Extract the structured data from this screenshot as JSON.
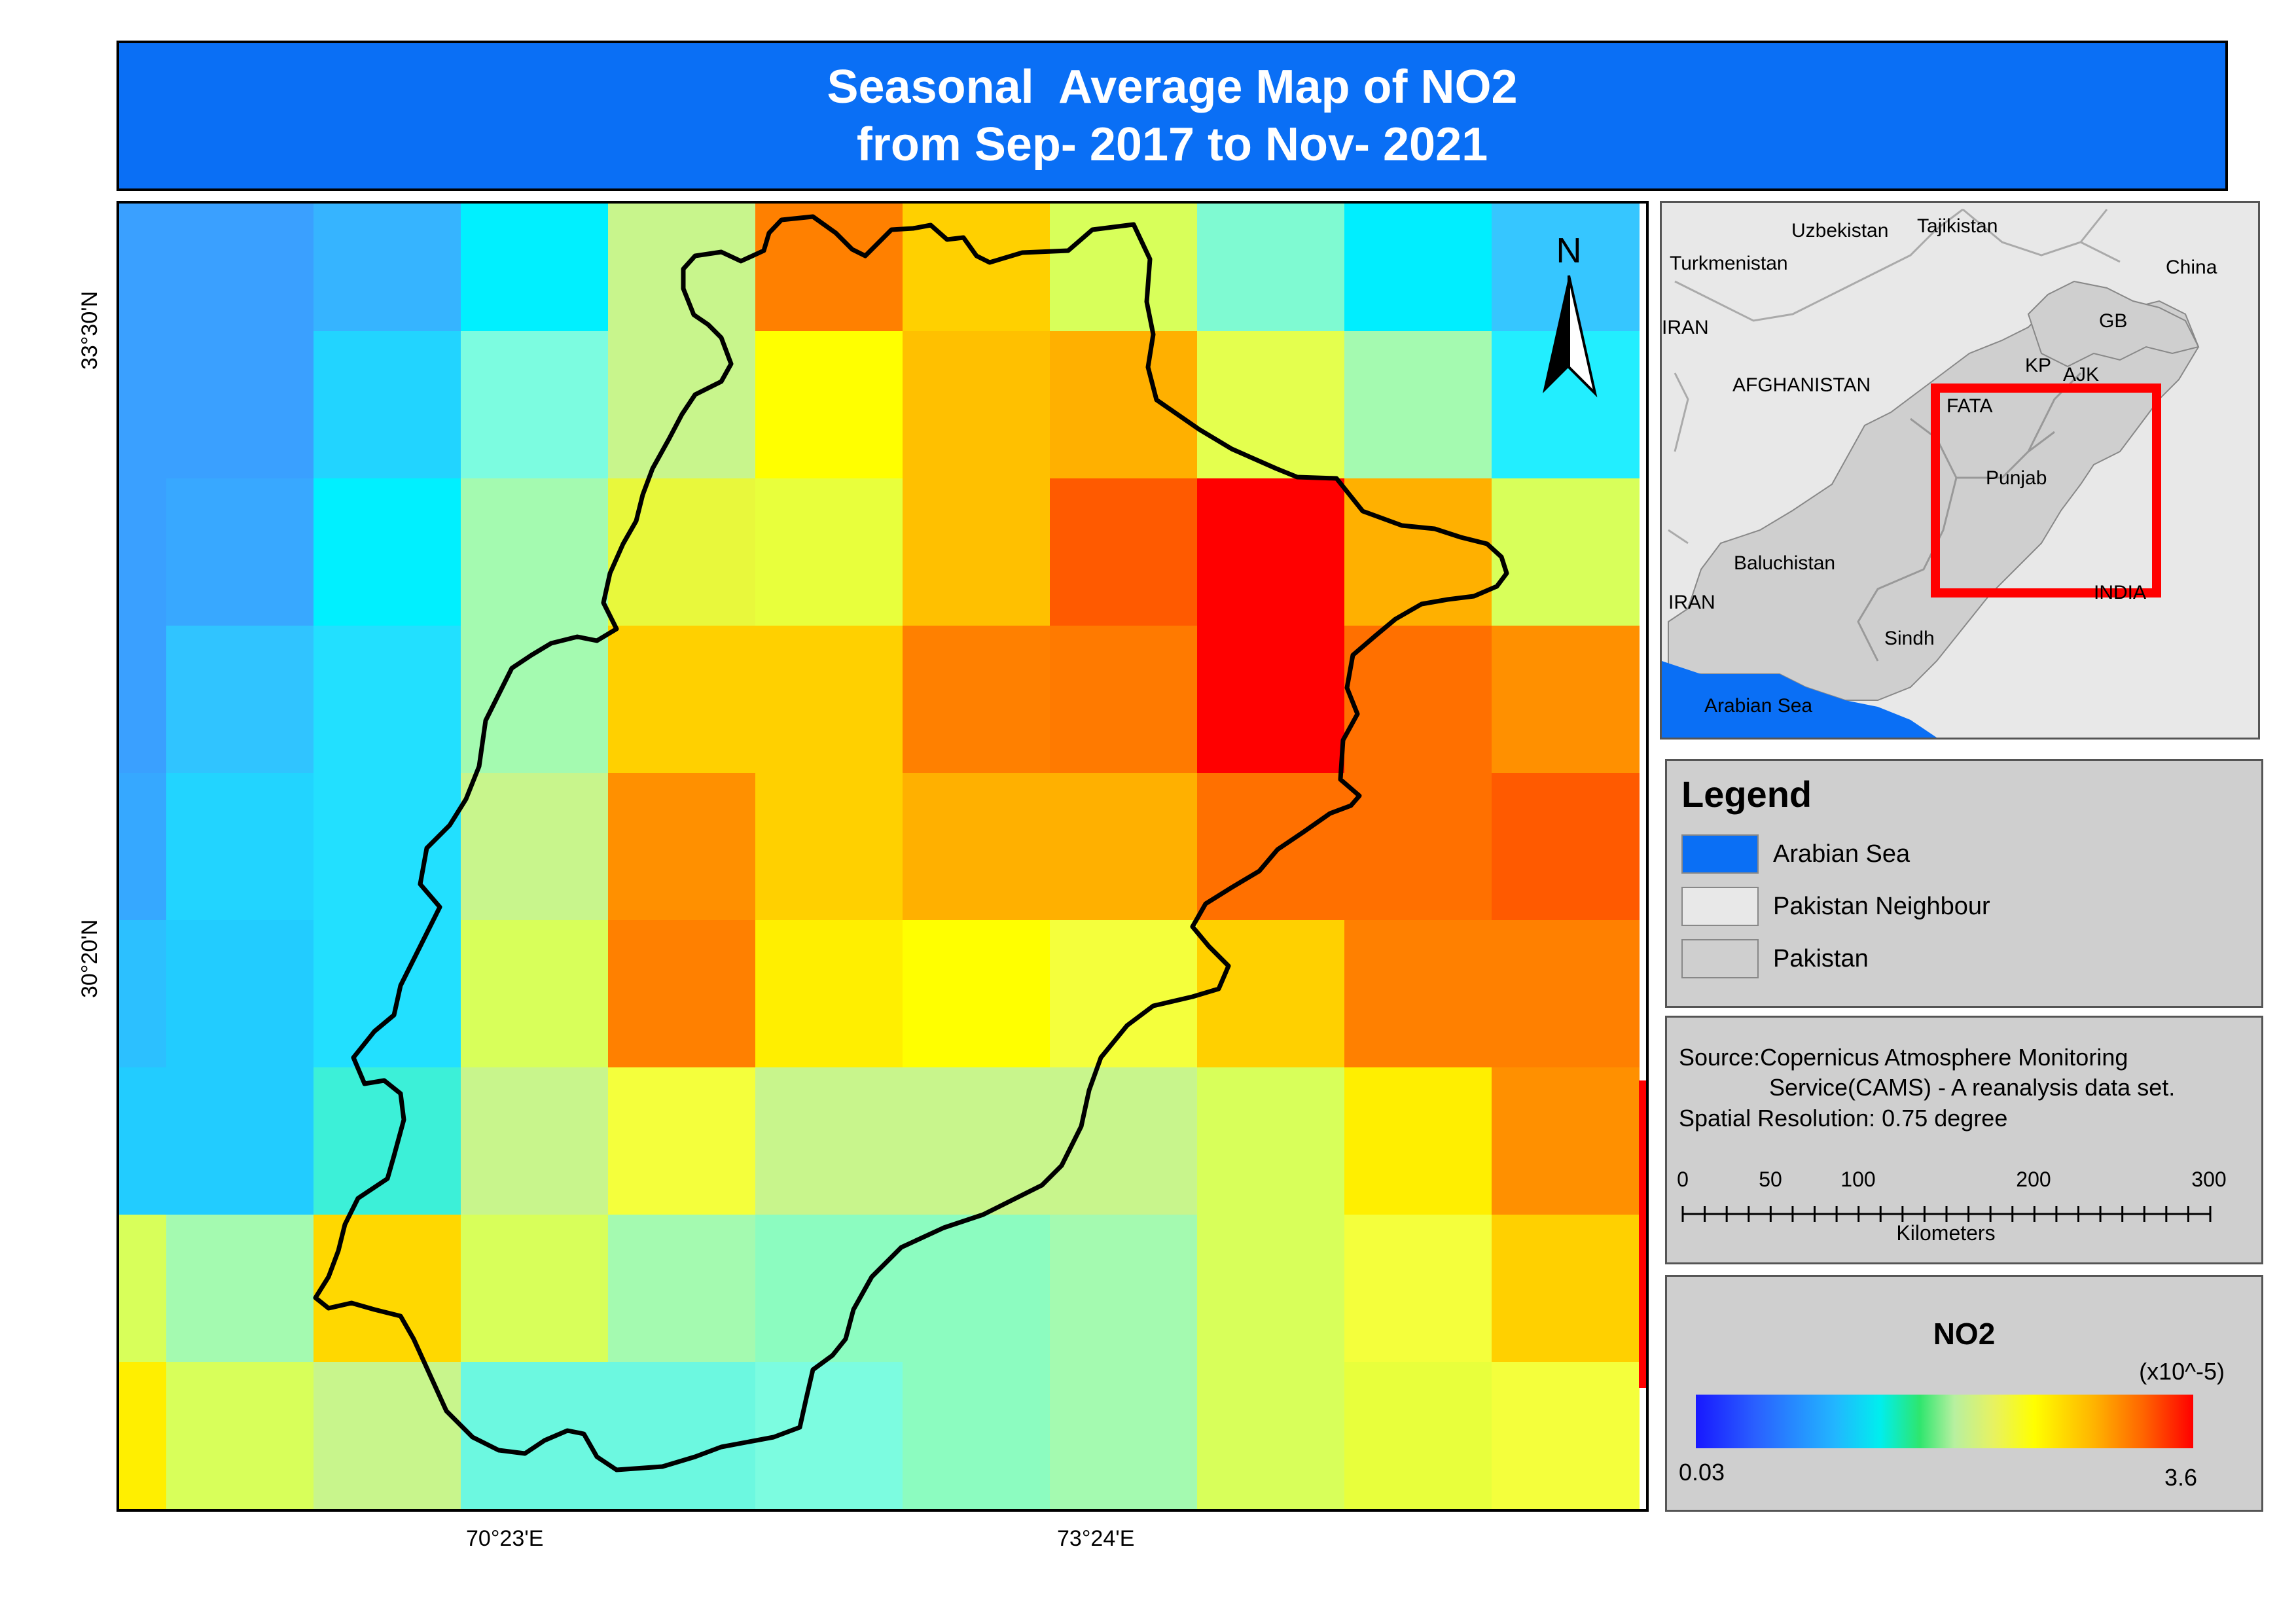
{
  "title": {
    "line1": "Seasonal  Average Map of NO2",
    "line2": "from Sep- 2017 to Nov- 2021"
  },
  "map": {
    "north_label": "N",
    "lat_labels": [
      "33°30'N",
      "30°20'N"
    ],
    "lon_labels": [
      "70°23'E",
      "73°24'E"
    ],
    "grid_colors": [
      [
        "#3aa0ff",
        "#3aa0ff",
        "#36b4ff",
        "#00f0ff",
        "#c8f58c",
        "#ff8000",
        "#ffd000",
        "#d8ff5a",
        "#7ffad2",
        "#00eeff",
        "#36c6ff"
      ],
      [
        "#3aa0ff",
        "#3aa0ff",
        "#22d4ff",
        "#7cfce0",
        "#c8f58c",
        "#ffff00",
        "#ffc000",
        "#ffb000",
        "#e4ff4e",
        "#a4fab0",
        "#22eeff"
      ],
      [
        "#3aa0ff",
        "#38a8ff",
        "#00f0ff",
        "#a4fab0",
        "#e8f83c",
        "#e8ff3c",
        "#ffc000",
        "#ff5a00",
        "#ff0000",
        "#ffb000",
        "#d8ff5a"
      ],
      [
        "#3aa0ff",
        "#30c4ff",
        "#22e0ff",
        "#a4fab0",
        "#ffd000",
        "#ffd000",
        "#ff8000",
        "#ff7a00",
        "#ff0000",
        "#ff7000",
        "#ff9000"
      ],
      [
        "#36a8ff",
        "#22d4ff",
        "#22e0ff",
        "#c8f58c",
        "#ff9000",
        "#ffd000",
        "#ffb000",
        "#ffb000",
        "#ff7000",
        "#ff7000",
        "#ff5a00"
      ],
      [
        "#2cc0ff",
        "#22ccff",
        "#22e0ff",
        "#d8ff5a",
        "#ff8000",
        "#ffef00",
        "#ffff00",
        "#f4ff3c",
        "#ffd000",
        "#ff8000",
        "#ff8000"
      ],
      [
        "#22ccff",
        "#22ccff",
        "#3cf0d8",
        "#c8f58c",
        "#f4ff3c",
        "#c8f58c",
        "#c8f58c",
        "#c8f58c",
        "#d8ff5a",
        "#ffef00",
        "#ff9000"
      ],
      [
        "#d8ff5a",
        "#a4fab0",
        "#ffd800",
        "#d8ff5a",
        "#a4fab0",
        "#8cfcc0",
        "#8cfcc0",
        "#a4fab0",
        "#d8ff5a",
        "#f4ff3c",
        "#ffd000"
      ],
      [
        "#ffef00",
        "#d8ff5a",
        "#c8f58c",
        "#6cf8e0",
        "#6cf8e0",
        "#7cfce0",
        "#8cfcc0",
        "#a4fab0",
        "#d8ff5a",
        "#e8ff3c",
        "#f4ff3c"
      ]
    ]
  },
  "inset": {
    "labels": [
      "Uzbekistan",
      "Tajikistan",
      "Turkmenistan",
      "China",
      "GB",
      "IRAN",
      "KP",
      "AJK",
      "AFGHANISTAN",
      "FATA",
      "Punjab",
      "Baluchistan",
      "IRAN",
      "INDIA",
      "Sindh",
      "Arabian Sea"
    ]
  },
  "legend": {
    "title": "Legend",
    "items": [
      {
        "label": "Arabian Sea",
        "color": "#0a6ff5"
      },
      {
        "label": "Pakistan Neighbour",
        "color": "#e8e8e8"
      },
      {
        "label": "Pakistan",
        "color": "#cfcfcf"
      }
    ]
  },
  "source": {
    "line1": "Source:Copernicus Atmosphere Monitoring",
    "line2": "Service(CAMS) - A reanalysis data set.",
    "line3": "Spatial Resolution: 0.75 degree"
  },
  "scale_bar": {
    "ticks": [
      "0",
      "50",
      "100",
      "200",
      "300"
    ],
    "unit": "Kilometers"
  },
  "colorbar": {
    "title": "NO2",
    "unit": "(x10^-5)",
    "min": "0.03",
    "max": "3.6"
  }
}
